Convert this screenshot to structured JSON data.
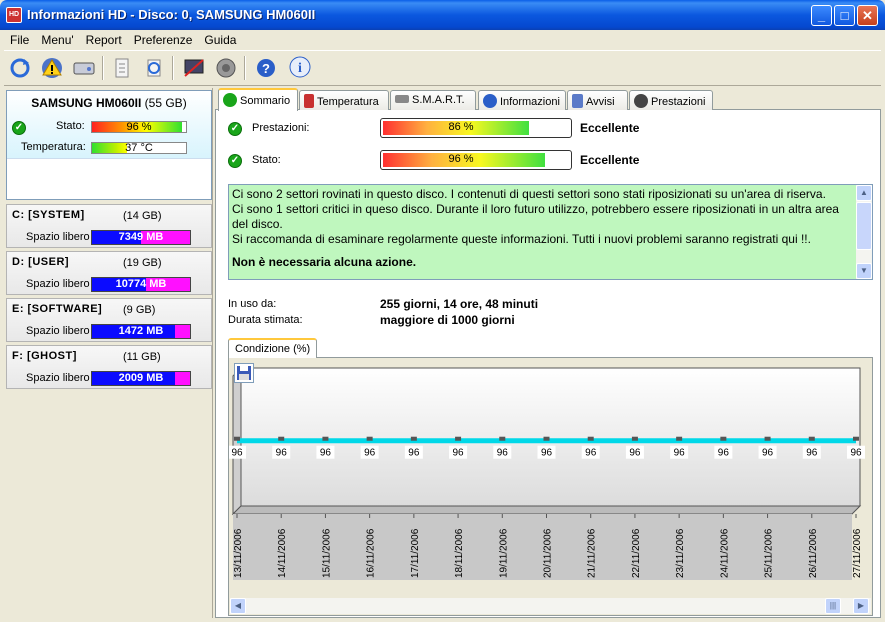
{
  "window": {
    "title": "Informazioni HD - Disco: 0, SAMSUNG HM060II",
    "app_icon_text": "HD"
  },
  "menu": [
    "File",
    "Menu'",
    "Report",
    "Preferenze",
    "Guida"
  ],
  "toolbar_icons": [
    "refresh-icon",
    "warning-icon",
    "disk-icon",
    "document-icon",
    "sync-icon",
    "disable-monitor-icon",
    "speaker-icon",
    "help-icon",
    "info-icon"
  ],
  "disk": {
    "name": "SAMSUNG HM060II",
    "size": "(55 GB)",
    "status_label": "Stato:",
    "status_value": "96 %",
    "status_pct": 96,
    "temp_label": "Temperatura:",
    "temp_value": "37 °C",
    "temp_pct": 37
  },
  "drives": [
    {
      "name": "C: [SYSTEM]",
      "size": "(14 GB)",
      "free_label": "Spazio libero",
      "free": "7349 MB",
      "free_fraction": 0.5
    },
    {
      "name": "D: [USER]",
      "size": "(19 GB)",
      "free_label": "Spazio libero",
      "free": "10774 MB",
      "free_fraction": 0.55
    },
    {
      "name": "E: [SOFTWARE]",
      "size": "(9 GB)",
      "free_label": "Spazio libero",
      "free": "1472 MB",
      "free_fraction": 0.85
    },
    {
      "name": "F: [GHOST]",
      "size": "(11 GB)",
      "free_label": "Spazio libero",
      "free": "2009 MB",
      "free_fraction": 0.85
    }
  ],
  "tabs": [
    {
      "label": "Sommario",
      "icon": "check-icon",
      "color": "#19a51a"
    },
    {
      "label": "Temperatura",
      "icon": "thermometer-icon",
      "color": "#c83030"
    },
    {
      "label": "S.M.A.R.T.",
      "icon": "disk-icon",
      "color": "#888888"
    },
    {
      "label": "Informazioni",
      "icon": "info-icon",
      "color": "#2a5ec8"
    },
    {
      "label": "Avvisi",
      "icon": "document-icon",
      "color": "#5a7ac8"
    },
    {
      "label": "Prestazioni",
      "icon": "gauge-icon",
      "color": "#444444"
    }
  ],
  "summary": {
    "perf_label": "Prestazioni:",
    "perf_value": "86 %",
    "perf_pct": 86,
    "perf_rating": "Eccellente",
    "health_label": "Stato:",
    "health_value": "96 %",
    "health_pct": 96,
    "health_rating": "Eccellente",
    "message_lines": [
      "Ci sono 2 settori rovinati in questo disco. I contenuti di questi settori sono stati riposizionati su un'area di riserva.",
      "Ci sono 1 settori critici in queso disco. Durante il loro futuro utilizzo, potrebbero essere riposizionati in un altra area del disco.",
      "Si raccomanda di esaminare regolarmente queste informazioni. Tutti i nuovi problemi saranno registrati qui !!."
    ],
    "message_action": "Non è necessaria alcuna azione.",
    "in_use_label": "In uso da:",
    "in_use_value": "255 giorni, 14 ore, 48 minuti",
    "estimate_label": "Durata stimata:",
    "estimate_value": "maggiore di 1000 giorni"
  },
  "chart_tab": "Condizione (%)",
  "chart_data": {
    "type": "line",
    "x": [
      "13/11/2006",
      "14/11/2006",
      "15/11/2006",
      "16/11/2006",
      "17/11/2006",
      "18/11/2006",
      "19/11/2006",
      "20/11/2006",
      "21/11/2006",
      "22/11/2006",
      "23/11/2006",
      "24/11/2006",
      "25/11/2006",
      "26/11/2006",
      "27/11/2006"
    ],
    "series": [
      {
        "values": [
          96,
          96,
          96,
          96,
          96,
          96,
          96,
          96,
          96,
          96,
          96,
          96,
          96,
          96,
          96
        ]
      }
    ],
    "ylim": [
      0,
      100
    ],
    "line_color": "#00d8e8"
  }
}
